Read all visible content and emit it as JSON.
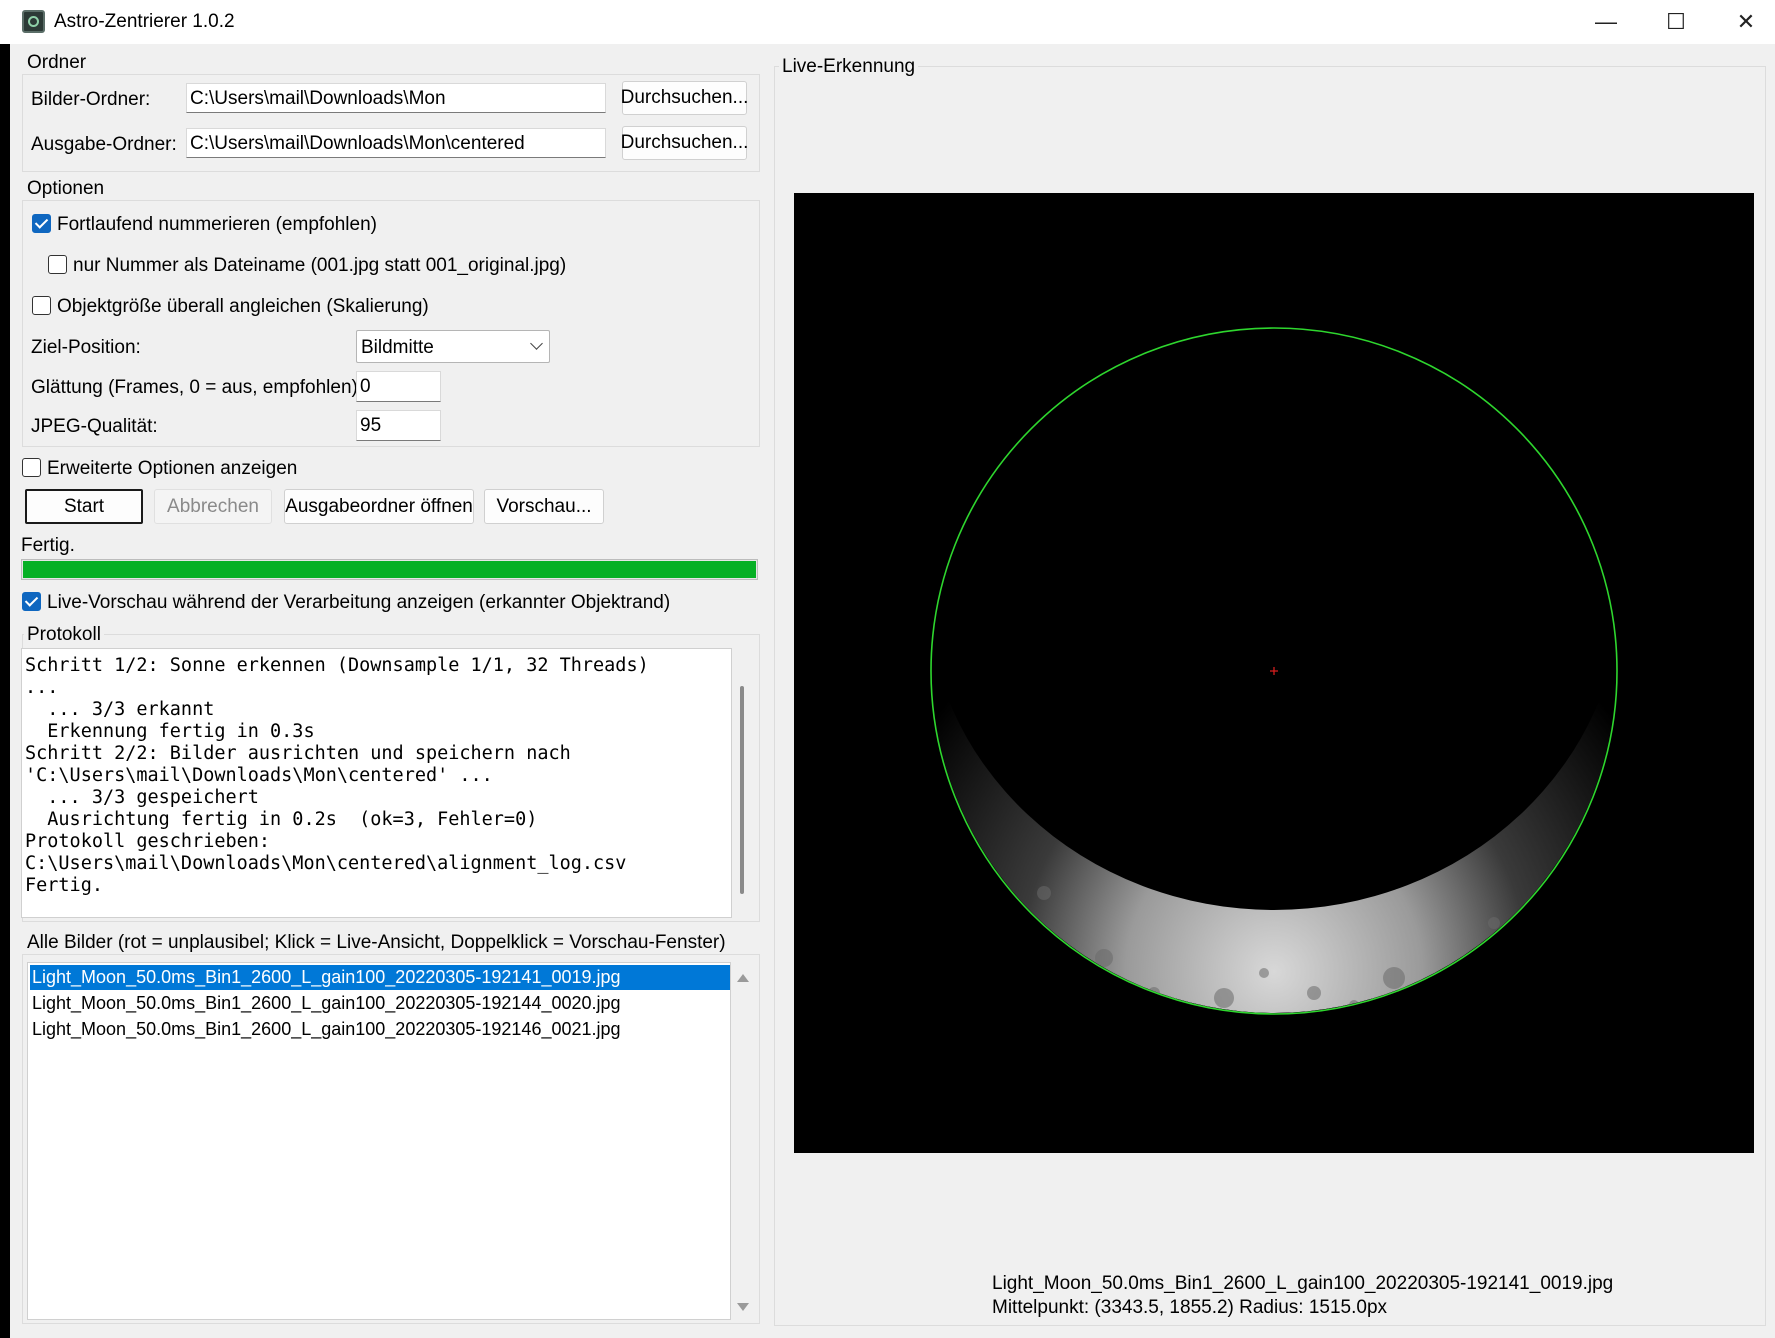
{
  "window": {
    "title": "Astro-Zentrierer 1.0.2",
    "controls": {
      "minimize": "—",
      "maximize": "☐",
      "close": "✕"
    }
  },
  "folders": {
    "group_label": "Ordner",
    "image_folder_label": "Bilder-Ordner:",
    "image_folder_value": "C:\\Users\\mail\\Downloads\\Mon",
    "output_folder_label": "Ausgabe-Ordner:",
    "output_folder_value": "C:\\Users\\mail\\Downloads\\Mon\\centered",
    "browse_label": "Durchsuchen..."
  },
  "options": {
    "group_label": "Optionen",
    "sequential_numbering": {
      "label": "Fortlaufend nummerieren (empfohlen)",
      "checked": true
    },
    "number_only": {
      "label": "nur Nummer als Dateiname (001.jpg statt 001_original.jpg)",
      "checked": false
    },
    "equalize_size": {
      "label": "Objektgröße überall angleichen (Skalierung)",
      "checked": false
    },
    "target_position_label": "Ziel-Position:",
    "target_position_value": "Bildmitte",
    "smoothing_label": "Glättung (Frames, 0 = aus, empfohlen):",
    "smoothing_value": "0",
    "jpeg_quality_label": "JPEG-Qualität:",
    "jpeg_quality_value": "95"
  },
  "advanced": {
    "label": "Erweiterte Optionen anzeigen",
    "checked": false
  },
  "actions": {
    "start": "Start",
    "cancel": "Abbrechen",
    "open_output": "Ausgabeordner öffnen",
    "preview": "Vorschau..."
  },
  "status": {
    "text": "Fertig.",
    "progress": 1.0,
    "progress_color": "#06b025"
  },
  "live_preview_toggle": {
    "label": "Live-Vorschau während der Verarbeitung anzeigen (erkannter Objektrand)",
    "checked": true
  },
  "log": {
    "group_label": "Protokoll",
    "lines": [
      "Schritt 1/2: Sonne erkennen (Downsample 1/1, 32 Threads)",
      "...",
      "  ... 3/3 erkannt",
      "  Erkennung fertig in 0.3s",
      "Schritt 2/2: Bilder ausrichten und speichern nach",
      "'C:\\Users\\mail\\Downloads\\Mon\\centered' ...",
      "  ... 3/3 gespeichert",
      "  Ausrichtung fertig in 0.2s  (ok=3, Fehler=0)",
      "Protokoll geschrieben:",
      "C:\\Users\\mail\\Downloads\\Mon\\centered\\alignment_log.csv",
      "Fertig."
    ]
  },
  "images": {
    "group_label": "Alle Bilder (rot = unplausibel; Klick = Live-Ansicht, Doppelklick = Vorschau-Fenster)",
    "items": [
      "Light_Moon_50.0ms_Bin1_2600_L_gain100_20220305-192141_0019.jpg",
      "Light_Moon_50.0ms_Bin1_2600_L_gain100_20220305-192144_0020.jpg",
      "Light_Moon_50.0ms_Bin1_2600_L_gain100_20220305-192146_0021.jpg"
    ],
    "selected_index": 0
  },
  "live": {
    "group_label": "Live-Erkennung",
    "filename": "Light_Moon_50.0ms_Bin1_2600_L_gain100_20220305-192141_0019.jpg",
    "center_text": "Mittelpunkt: (3343.5, 1855.2)  Radius: 1515.0px",
    "circle_color": "#2ed62e",
    "center_marker_color": "#e02020"
  }
}
